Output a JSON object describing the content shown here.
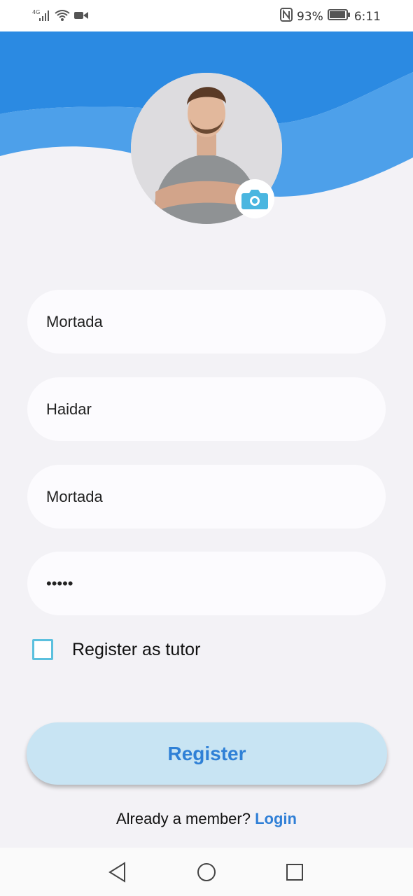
{
  "status_bar": {
    "network": "4G",
    "battery": "93%",
    "time": "6:11"
  },
  "profile": {
    "avatar_icon": "person-avatar",
    "camera_icon": "camera-icon"
  },
  "form": {
    "first_name": "Mortada",
    "last_name": "Haidar",
    "username": "Mortada",
    "password": "•••••"
  },
  "checkbox": {
    "label": "Register as tutor",
    "checked": false
  },
  "register_button": {
    "label": "Register"
  },
  "login": {
    "prompt": "Already a member?",
    "link": "Login"
  },
  "colors": {
    "accent": "#2f80d6",
    "wave_dark": "#2b8ae2",
    "wave_light": "#4da0ea",
    "checkbox": "#5bc0de",
    "button_bg": "#c8e4f3"
  }
}
